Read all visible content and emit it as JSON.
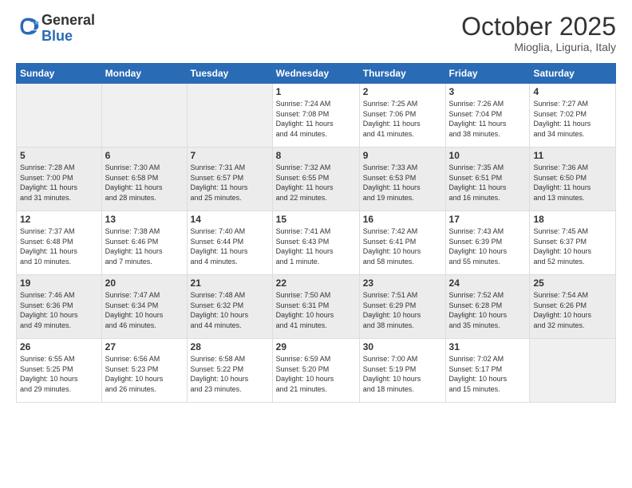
{
  "header": {
    "logo_line1": "General",
    "logo_line2": "Blue",
    "month": "October 2025",
    "location": "Mioglia, Liguria, Italy"
  },
  "days_of_week": [
    "Sunday",
    "Monday",
    "Tuesday",
    "Wednesday",
    "Thursday",
    "Friday",
    "Saturday"
  ],
  "weeks": [
    {
      "alt": false,
      "days": [
        {
          "num": "",
          "info": ""
        },
        {
          "num": "",
          "info": ""
        },
        {
          "num": "",
          "info": ""
        },
        {
          "num": "1",
          "info": "Sunrise: 7:24 AM\nSunset: 7:08 PM\nDaylight: 11 hours\nand 44 minutes."
        },
        {
          "num": "2",
          "info": "Sunrise: 7:25 AM\nSunset: 7:06 PM\nDaylight: 11 hours\nand 41 minutes."
        },
        {
          "num": "3",
          "info": "Sunrise: 7:26 AM\nSunset: 7:04 PM\nDaylight: 11 hours\nand 38 minutes."
        },
        {
          "num": "4",
          "info": "Sunrise: 7:27 AM\nSunset: 7:02 PM\nDaylight: 11 hours\nand 34 minutes."
        }
      ]
    },
    {
      "alt": true,
      "days": [
        {
          "num": "5",
          "info": "Sunrise: 7:28 AM\nSunset: 7:00 PM\nDaylight: 11 hours\nand 31 minutes."
        },
        {
          "num": "6",
          "info": "Sunrise: 7:30 AM\nSunset: 6:58 PM\nDaylight: 11 hours\nand 28 minutes."
        },
        {
          "num": "7",
          "info": "Sunrise: 7:31 AM\nSunset: 6:57 PM\nDaylight: 11 hours\nand 25 minutes."
        },
        {
          "num": "8",
          "info": "Sunrise: 7:32 AM\nSunset: 6:55 PM\nDaylight: 11 hours\nand 22 minutes."
        },
        {
          "num": "9",
          "info": "Sunrise: 7:33 AM\nSunset: 6:53 PM\nDaylight: 11 hours\nand 19 minutes."
        },
        {
          "num": "10",
          "info": "Sunrise: 7:35 AM\nSunset: 6:51 PM\nDaylight: 11 hours\nand 16 minutes."
        },
        {
          "num": "11",
          "info": "Sunrise: 7:36 AM\nSunset: 6:50 PM\nDaylight: 11 hours\nand 13 minutes."
        }
      ]
    },
    {
      "alt": false,
      "days": [
        {
          "num": "12",
          "info": "Sunrise: 7:37 AM\nSunset: 6:48 PM\nDaylight: 11 hours\nand 10 minutes."
        },
        {
          "num": "13",
          "info": "Sunrise: 7:38 AM\nSunset: 6:46 PM\nDaylight: 11 hours\nand 7 minutes."
        },
        {
          "num": "14",
          "info": "Sunrise: 7:40 AM\nSunset: 6:44 PM\nDaylight: 11 hours\nand 4 minutes."
        },
        {
          "num": "15",
          "info": "Sunrise: 7:41 AM\nSunset: 6:43 PM\nDaylight: 11 hours\nand 1 minute."
        },
        {
          "num": "16",
          "info": "Sunrise: 7:42 AM\nSunset: 6:41 PM\nDaylight: 10 hours\nand 58 minutes."
        },
        {
          "num": "17",
          "info": "Sunrise: 7:43 AM\nSunset: 6:39 PM\nDaylight: 10 hours\nand 55 minutes."
        },
        {
          "num": "18",
          "info": "Sunrise: 7:45 AM\nSunset: 6:37 PM\nDaylight: 10 hours\nand 52 minutes."
        }
      ]
    },
    {
      "alt": true,
      "days": [
        {
          "num": "19",
          "info": "Sunrise: 7:46 AM\nSunset: 6:36 PM\nDaylight: 10 hours\nand 49 minutes."
        },
        {
          "num": "20",
          "info": "Sunrise: 7:47 AM\nSunset: 6:34 PM\nDaylight: 10 hours\nand 46 minutes."
        },
        {
          "num": "21",
          "info": "Sunrise: 7:48 AM\nSunset: 6:32 PM\nDaylight: 10 hours\nand 44 minutes."
        },
        {
          "num": "22",
          "info": "Sunrise: 7:50 AM\nSunset: 6:31 PM\nDaylight: 10 hours\nand 41 minutes."
        },
        {
          "num": "23",
          "info": "Sunrise: 7:51 AM\nSunset: 6:29 PM\nDaylight: 10 hours\nand 38 minutes."
        },
        {
          "num": "24",
          "info": "Sunrise: 7:52 AM\nSunset: 6:28 PM\nDaylight: 10 hours\nand 35 minutes."
        },
        {
          "num": "25",
          "info": "Sunrise: 7:54 AM\nSunset: 6:26 PM\nDaylight: 10 hours\nand 32 minutes."
        }
      ]
    },
    {
      "alt": false,
      "days": [
        {
          "num": "26",
          "info": "Sunrise: 6:55 AM\nSunset: 5:25 PM\nDaylight: 10 hours\nand 29 minutes."
        },
        {
          "num": "27",
          "info": "Sunrise: 6:56 AM\nSunset: 5:23 PM\nDaylight: 10 hours\nand 26 minutes."
        },
        {
          "num": "28",
          "info": "Sunrise: 6:58 AM\nSunset: 5:22 PM\nDaylight: 10 hours\nand 23 minutes."
        },
        {
          "num": "29",
          "info": "Sunrise: 6:59 AM\nSunset: 5:20 PM\nDaylight: 10 hours\nand 21 minutes."
        },
        {
          "num": "30",
          "info": "Sunrise: 7:00 AM\nSunset: 5:19 PM\nDaylight: 10 hours\nand 18 minutes."
        },
        {
          "num": "31",
          "info": "Sunrise: 7:02 AM\nSunset: 5:17 PM\nDaylight: 10 hours\nand 15 minutes."
        },
        {
          "num": "",
          "info": ""
        }
      ]
    }
  ]
}
